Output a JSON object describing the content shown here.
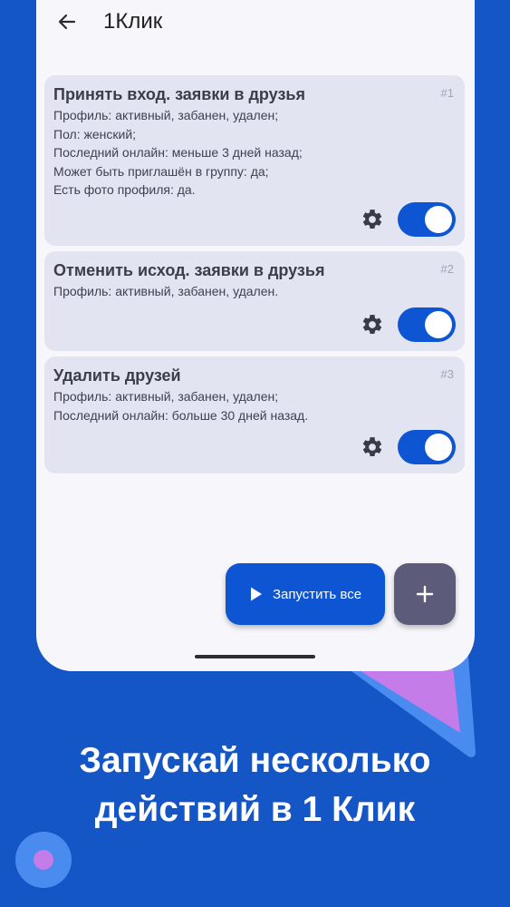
{
  "app": {
    "title": "1Клик",
    "back_icon": "arrow-left-icon"
  },
  "cards": [
    {
      "title": "Принять вход. заявки в друзья",
      "number": "#1",
      "lines": [
        "Профиль: активный, забанен, удален;",
        "Пол: женский;",
        "Последний онлайн: меньше 3 дней назад;",
        "Может быть приглашён в группу: да;",
        "Есть фото профиля: да."
      ],
      "enabled": true
    },
    {
      "title": "Отменить исход. заявки в друзья",
      "number": "#2",
      "lines": [
        "Профиль: активный, забанен, удален."
      ],
      "enabled": true
    },
    {
      "title": "Удалить друзей",
      "number": "#3",
      "lines": [
        "Профиль: активный, забанен, удален;",
        "Последний онлайн: больше 30 дней назад."
      ],
      "enabled": true
    }
  ],
  "actions": {
    "run_all_label": "Запустить все",
    "run_icon": "play-icon",
    "add_icon": "plus-icon"
  },
  "promo": {
    "line1": "Запускай несколько",
    "line2": "действий в 1 Клик"
  },
  "colors": {
    "background": "#1556c7",
    "card": "#e2e4f2",
    "accent": "#0d55d3",
    "add_button": "#5c5b7a",
    "triangle": "#c47ce8"
  }
}
